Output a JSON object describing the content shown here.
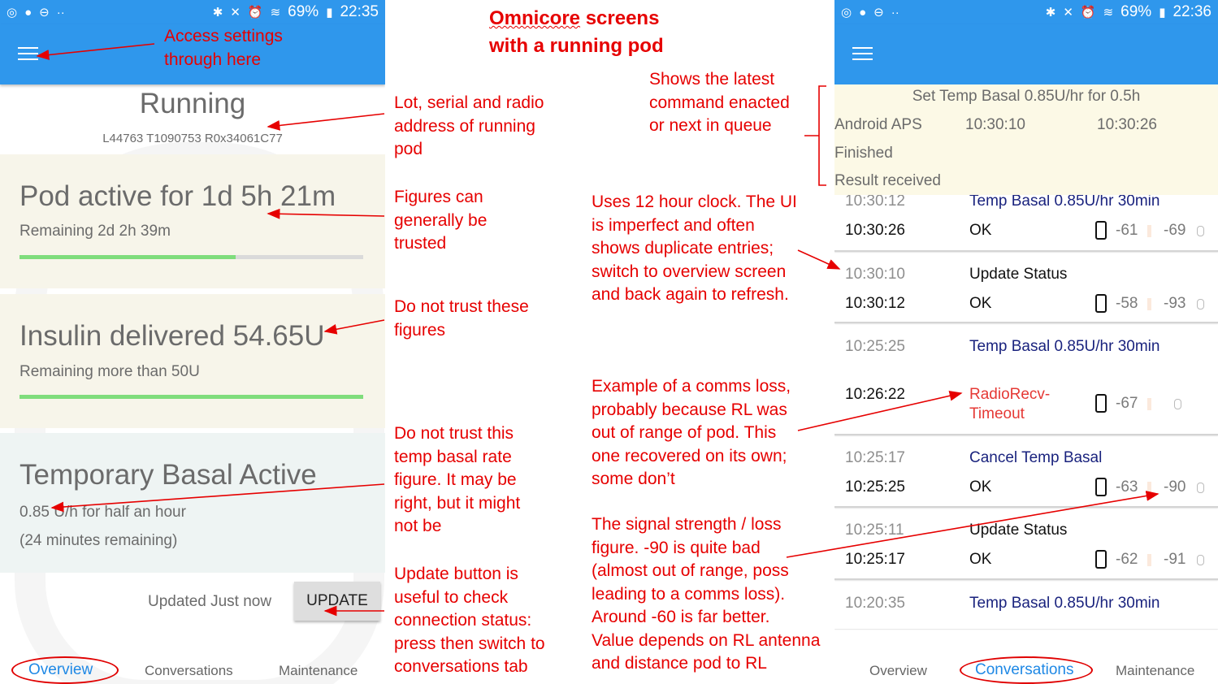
{
  "title": {
    "line1_prefix": "Omnicore",
    "line1_rest": " screens",
    "line2": "with a running pod"
  },
  "status_bar": {
    "battery": "69%",
    "time": "22:35",
    "time_right": "22:36",
    "left_icons": [
      "android-circle-icon",
      "water-drop-icon",
      "do-not-disturb-icon",
      "more-icon"
    ]
  },
  "overview": {
    "state": "Running",
    "ids": "L44763 T1090753 R0x34061C77",
    "pod_active": "Pod active for 1d 5h 21m",
    "pod_remaining": "Remaining  2d 2h 39m",
    "pod_progress": 0.63,
    "insulin": "Insulin delivered 54.65U",
    "insulin_remaining": "Remaining  more than 50U",
    "insulin_progress": 1.0,
    "temp_basal": "Temporary Basal Active",
    "temp_rate": "0.85 U/h for half an hour",
    "temp_left": "(24 minutes remaining)",
    "updated": "Updated  Just now",
    "update_button": "UPDATE"
  },
  "tabs": {
    "overview": "Overview",
    "conversations": "Conversations",
    "maintenance": "Maintenance"
  },
  "conversations": {
    "current": {
      "title": "Set Temp Basal 0.85U/hr for 0.5h",
      "source": "Android APS",
      "t1": "10:30:10",
      "t2": "10:30:26",
      "state": "Finished",
      "result": "Result received"
    },
    "rows": [
      {
        "t1": "10:30:12",
        "t2": "10:30:26",
        "cmd": "Temp Basal 0.85U/hr 30min",
        "res": "OK",
        "s1": "-61",
        "s2": "-69"
      },
      {
        "t1": "10:30:10",
        "t2": "10:30:12",
        "cmd": "Update Status",
        "res": "OK",
        "s1": "-58",
        "s2": "-93"
      },
      {
        "t1": "10:25:25",
        "t2": "10:26:22",
        "cmd": "Temp Basal 0.85U/hr 30min",
        "res": "RadioRecv-\nTimeout",
        "s1": "-67",
        "s2": ""
      },
      {
        "t1": "10:25:17",
        "t2": "10:25:25",
        "cmd": "Cancel Temp Basal",
        "res": "OK",
        "s1": "-63",
        "s2": "-90"
      },
      {
        "t1": "10:25:11",
        "t2": "10:25:17",
        "cmd": "Update Status",
        "res": "OK",
        "s1": "-62",
        "s2": "-91"
      },
      {
        "t1": "10:20:35",
        "t2": "",
        "cmd": "Temp Basal 0.85U/hr 30min",
        "res": "",
        "s1": "",
        "s2": ""
      }
    ]
  },
  "annotations": {
    "settings": [
      "Access settings",
      "through here"
    ],
    "lot": [
      "Lot, serial and radio",
      "address of running",
      "pod"
    ],
    "figures": [
      "Figures can",
      "generally be",
      "trusted"
    ],
    "not_trust": [
      "Do not trust these",
      "figures"
    ],
    "temp": [
      "Do not trust this",
      "temp basal rate",
      "figure. It may be",
      "right, but it might",
      "not be"
    ],
    "update": [
      "Update button is",
      "useful to check",
      "connection status:",
      "press then switch to",
      "conversations tab"
    ],
    "latest": [
      "Shows the latest",
      "command enacted",
      "or next in queue"
    ],
    "clock": [
      "Uses 12 hour clock. The UI",
      "is imperfect and often",
      "shows duplicate entries;",
      "switch to overview screen",
      "and back again to refresh."
    ],
    "comms": [
      "Example of a comms loss,",
      "probably because RL was",
      "out of range of pod. This",
      "one recovered on its own;",
      "some don’t"
    ],
    "signal": [
      "The signal strength / loss",
      "figure. -90 is quite bad",
      "(almost out of range, poss",
      "leading to a comms loss).",
      "Around -60 is far better.",
      "Value depends on RL antenna",
      "and distance pod to RL"
    ]
  },
  "colors": {
    "header": "#2f97ec",
    "annotation": "#e60000",
    "progress": "#7fdd7c",
    "command_text": "#1a237e",
    "error": "#e53935"
  }
}
